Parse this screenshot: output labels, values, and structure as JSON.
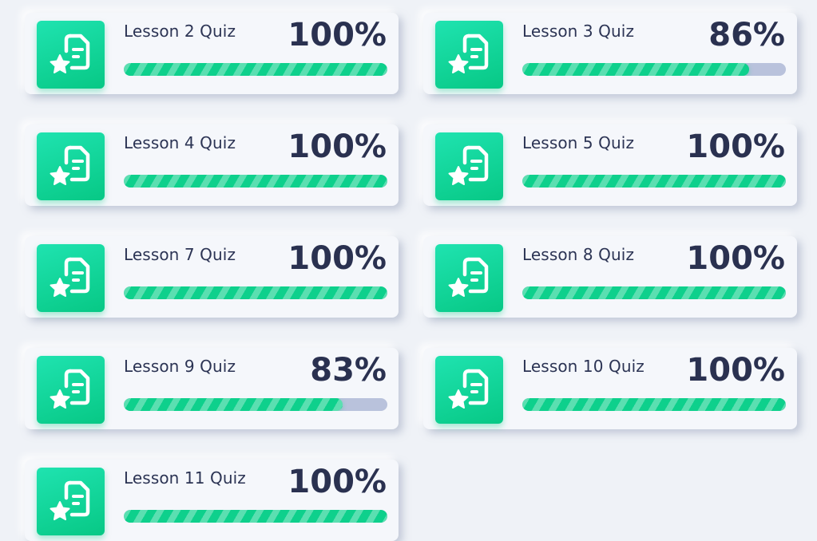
{
  "colors": {
    "background": "#eff2f7",
    "card": "#f5f7fb",
    "accent_green": "#0ed08c",
    "track": "#b9c2dc",
    "text": "#2c3454"
  },
  "quizzes": [
    {
      "label": "Lesson 2 Quiz",
      "percent_text": "100%",
      "progress": 1.0,
      "icon": "quiz-document-star-icon"
    },
    {
      "label": "Lesson 3 Quiz",
      "percent_text": "86%",
      "progress": 0.86,
      "icon": "quiz-document-star-icon"
    },
    {
      "label": "Lesson 4 Quiz",
      "percent_text": "100%",
      "progress": 1.0,
      "icon": "quiz-document-star-icon"
    },
    {
      "label": "Lesson 5 Quiz",
      "percent_text": "100%",
      "progress": 1.0,
      "icon": "quiz-document-star-icon"
    },
    {
      "label": "Lesson 7 Quiz",
      "percent_text": "100%",
      "progress": 1.0,
      "icon": "quiz-document-star-icon"
    },
    {
      "label": "Lesson 8 Quiz",
      "percent_text": "100%",
      "progress": 1.0,
      "icon": "quiz-document-star-icon"
    },
    {
      "label": "Lesson 9 Quiz",
      "percent_text": "83%",
      "progress": 0.83,
      "icon": "quiz-document-star-icon"
    },
    {
      "label": "Lesson 10 Quiz",
      "percent_text": "100%",
      "progress": 1.0,
      "icon": "quiz-document-star-icon"
    },
    {
      "label": "Lesson 11 Quiz",
      "percent_text": "100%",
      "progress": 1.0,
      "icon": "quiz-document-star-icon"
    }
  ]
}
